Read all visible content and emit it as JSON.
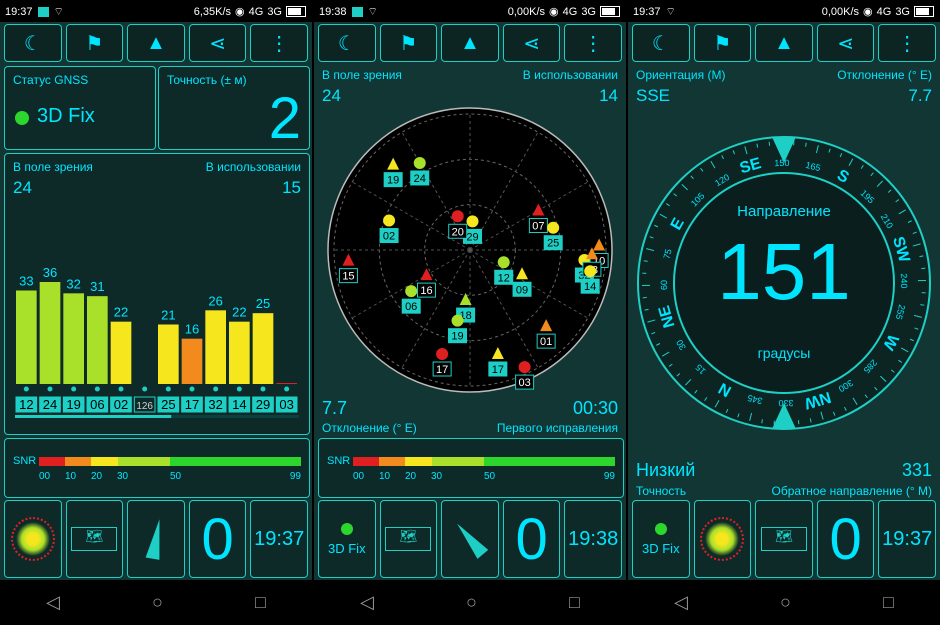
{
  "phones": [
    {
      "time": "19:37",
      "speed": "6,35K/s",
      "net": "4G",
      "net2": "3G",
      "gnss_label": "Статус GNSS",
      "fix": "3D Fix",
      "acc_label": "Точность (± м)",
      "acc_value": "2",
      "inview_label": "В поле зрения",
      "inuse_label": "В использовании",
      "inview": "24",
      "inuse": "15",
      "snr_label": "SNR",
      "snr_ticks": [
        "00",
        "10",
        "20",
        "30",
        "50",
        "99"
      ],
      "bottom_value": "0",
      "bottom_time": "19:37"
    },
    {
      "time": "19:38",
      "speed": "0,00K/s",
      "net": "4G",
      "net2": "3G",
      "inview_label": "В поле зрения",
      "inuse_label": "В использовании",
      "inview": "24",
      "inuse": "14",
      "dev_value": "7.7",
      "ttff_value": "00:30",
      "dev_label": "Отклонение (° E)",
      "ttff_label": "Первого исправления",
      "snr_label": "SNR",
      "snr_ticks": [
        "00",
        "10",
        "20",
        "30",
        "50",
        "99"
      ],
      "fix": "3D Fix",
      "bottom_value": "0",
      "bottom_time": "19:38"
    },
    {
      "time": "19:37",
      "speed": "0,00K/s",
      "net": "4G",
      "net2": "3G",
      "orient_label": "Ориентация (M)",
      "dev_label": "Отклонение (° E)",
      "orient_value": "SSE",
      "dev_value": "7.7",
      "dir_label": "Направление",
      "heading": "151",
      "deg_label": "градусы",
      "accuracy_value": "Низкий",
      "accuracy_label": "Точность",
      "back_value": "331",
      "back_label": "Обратное направление (° M)",
      "fix": "3D Fix",
      "bottom_value": "0",
      "bottom_time": "19:37"
    }
  ],
  "chart_data": {
    "type": "bar",
    "title": "",
    "categories": [
      "12",
      "24",
      "19",
      "06",
      "02",
      "126",
      "25",
      "17",
      "32",
      "14",
      "29",
      "03"
    ],
    "values": [
      33,
      36,
      32,
      31,
      22,
      0,
      21,
      16,
      26,
      22,
      25,
      0
    ],
    "colors": [
      "#a8e02a",
      "#a8e02a",
      "#a8e02a",
      "#a8e02a",
      "#f5e61e",
      "#000000",
      "#f5e61e",
      "#f28a1e",
      "#f5e61e",
      "#f5e61e",
      "#f5e61e",
      "#e02020"
    ],
    "ylim": [
      0,
      60
    ]
  },
  "sky": {
    "satellites": [
      {
        "id": "29",
        "az": 5,
        "el": 70,
        "shape": "circle",
        "color": "#f5e61e",
        "used": true
      },
      {
        "id": "20",
        "az": 340,
        "el": 65,
        "shape": "circle",
        "color": "#e02020",
        "used": false
      },
      {
        "id": "07",
        "az": 60,
        "el": 35,
        "shape": "triangle",
        "color": "#e02020",
        "used": false
      },
      {
        "id": "25",
        "az": 75,
        "el": 30,
        "shape": "circle",
        "color": "#f5e61e",
        "used": true
      },
      {
        "id": "02",
        "az": 290,
        "el": 30,
        "shape": "circle",
        "color": "#f5e61e",
        "used": true
      },
      {
        "id": "19",
        "az": 318,
        "el": 10,
        "shape": "triangle",
        "color": "#f5e61e",
        "used": true
      },
      {
        "id": "24",
        "az": 330,
        "el": 20,
        "shape": "circle",
        "color": "#a8e02a",
        "used": true
      },
      {
        "id": "12",
        "az": 110,
        "el": 65,
        "shape": "circle",
        "color": "#a8e02a",
        "used": true
      },
      {
        "id": "09",
        "az": 115,
        "el": 50,
        "shape": "triangle",
        "color": "#f5e61e",
        "used": true
      },
      {
        "id": "32",
        "az": 95,
        "el": 10,
        "shape": "circle",
        "color": "#f5e61e",
        "used": true
      },
      {
        "id": "10",
        "az": 88,
        "el": 0,
        "shape": "triangle",
        "color": "#f28a1e",
        "used": false
      },
      {
        "id": "08",
        "az": 92,
        "el": 5,
        "shape": "triangle",
        "color": "#f28a1e",
        "used": false
      },
      {
        "id": "14",
        "az": 100,
        "el": 5,
        "shape": "circle",
        "color": "#f5e61e",
        "used": true
      },
      {
        "id": "15",
        "az": 265,
        "el": 5,
        "shape": "triangle",
        "color": "#e02020",
        "used": false
      },
      {
        "id": "16",
        "az": 240,
        "el": 55,
        "shape": "triangle",
        "color": "#e02020",
        "used": false
      },
      {
        "id": "06",
        "az": 235,
        "el": 40,
        "shape": "circle",
        "color": "#a8e02a",
        "used": true
      },
      {
        "id": "18",
        "az": 185,
        "el": 55,
        "shape": "triangle",
        "color": "#a8e02a",
        "used": true
      },
      {
        "id": "19b",
        "az": 190,
        "el": 40,
        "shape": "circle",
        "color": "#a8e02a",
        "used": true
      },
      {
        "id": "01",
        "az": 135,
        "el": 15,
        "shape": "triangle",
        "color": "#f28a1e",
        "used": false
      },
      {
        "id": "17",
        "az": 195,
        "el": 15,
        "shape": "circle",
        "color": "#e02020",
        "used": false
      },
      {
        "id": "17b",
        "az": 165,
        "el": 15,
        "shape": "triangle",
        "color": "#f5e61e",
        "used": true
      },
      {
        "id": "03",
        "az": 155,
        "el": 0,
        "shape": "circle",
        "color": "#e02020",
        "used": false
      }
    ]
  },
  "nav": {
    "back": "◁",
    "home": "○",
    "recent": "□"
  },
  "icons": [
    "moon-icon",
    "person-flag-icon",
    "navigation-arrow-icon",
    "share-icon",
    "more-vertical-icon"
  ]
}
